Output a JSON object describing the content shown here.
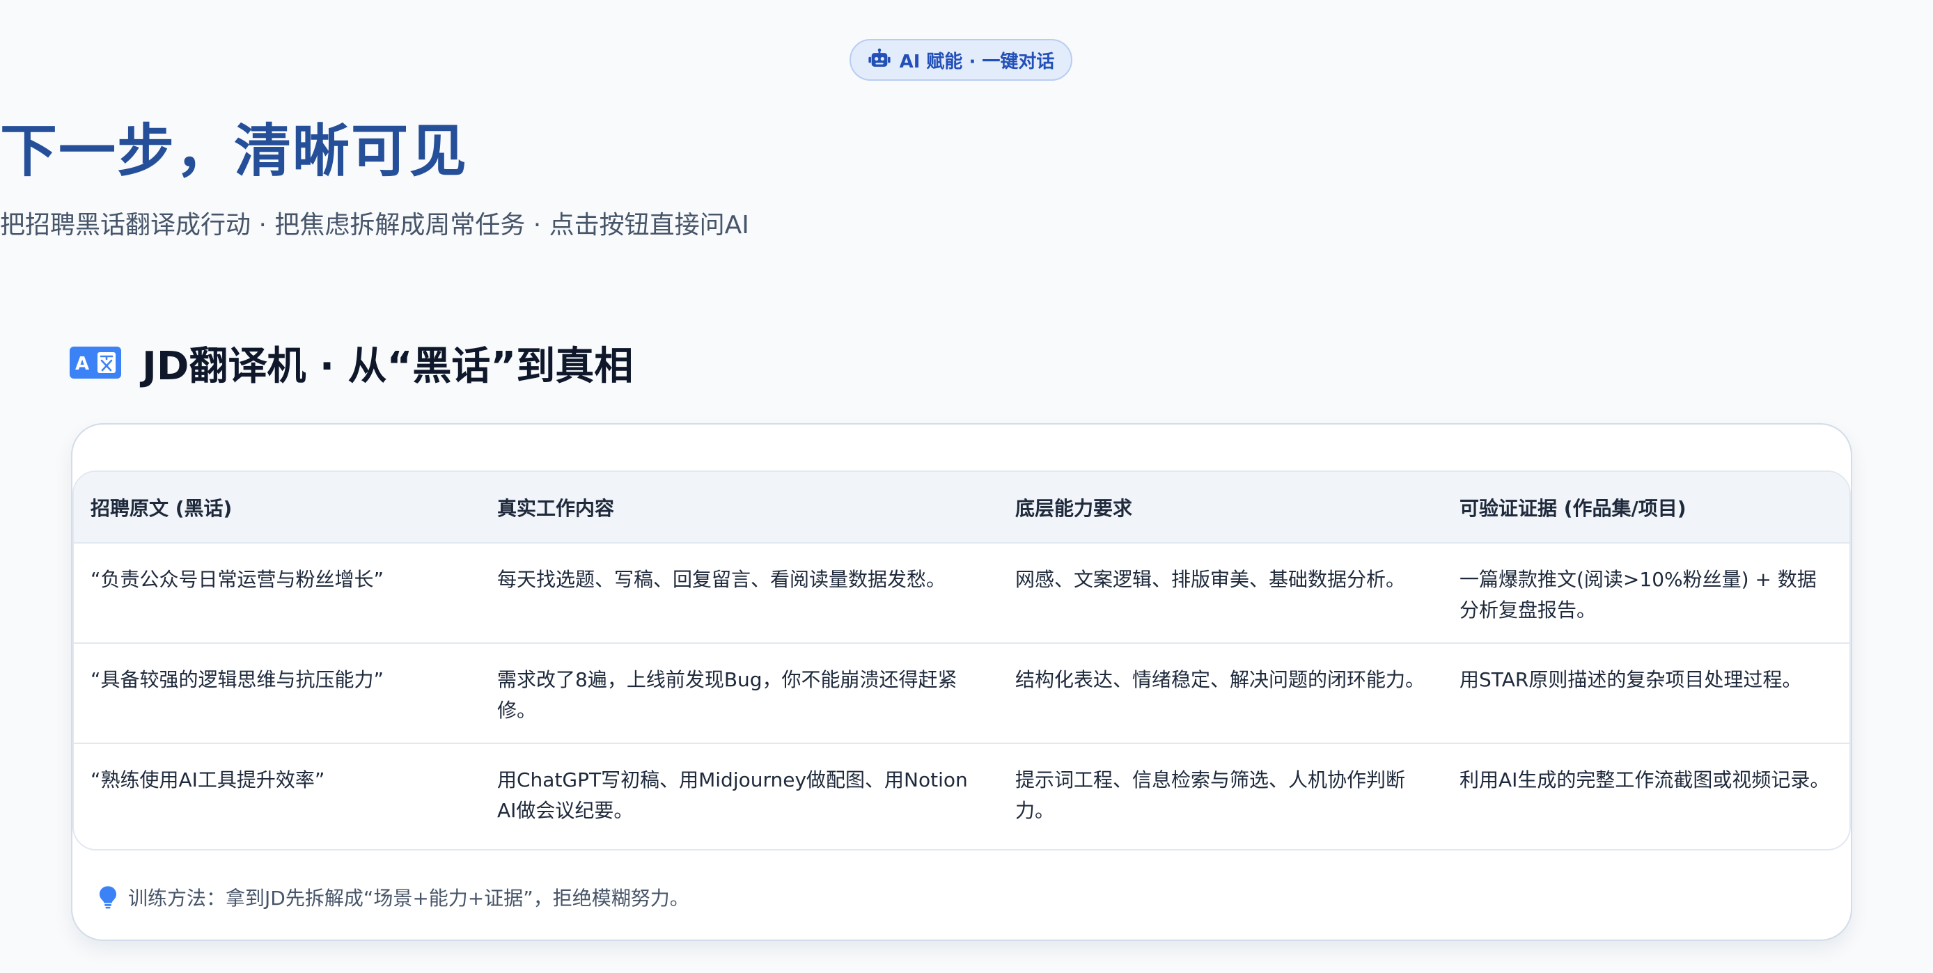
{
  "hero": {
    "badge_icon": "robot-icon",
    "badge_label": "AI 赋能 · 一键对话",
    "title": "下一步，清晰可见",
    "subtitle": "把招聘黑话翻译成行动 · 把焦虑拆解成周常任务 · 点击按钮直接问AI"
  },
  "section": {
    "icon": "translate-icon",
    "title": "JD翻译机 · 从“黑话”到真相"
  },
  "table": {
    "headers": [
      "招聘原文 (黑话)",
      "真实工作内容",
      "底层能力要求",
      "可验证证据 (作品集/项目)"
    ],
    "rows": [
      [
        "“负责公众号日常运营与粉丝增长”",
        "每天找选题、写稿、回复留言、看阅读量数据发愁。",
        "网感、文案逻辑、排版审美、基础数据分析。",
        "一篇爆款推文(阅读>10%粉丝量) + 数据分析复盘报告。"
      ],
      [
        "“具备较强的逻辑思维与抗压能力”",
        "需求改了8遍，上线前发现Bug，你不能崩溃还得赶紧修。",
        "结构化表达、情绪稳定、解决问题的闭环能力。",
        "用STAR原则描述的复杂项目处理过程。"
      ],
      [
        "“熟练使用AI工具提升效率”",
        "用ChatGPT写初稿、用Midjourney做配图、用Notion AI做会议纪要。",
        "提示词工程、信息检索与筛选、人机协作判断力。",
        "利用AI生成的完整工作流截图或视频记录。"
      ]
    ]
  },
  "tip": {
    "icon": "lightbulb-icon",
    "text": "训练方法：拿到JD先拆解成“场景+能力+证据”，拒绝模糊努力。"
  },
  "colors": {
    "accent": "#254f98",
    "badge_bg": "#e3ecfb",
    "icon_blue": "#3b82f6"
  }
}
